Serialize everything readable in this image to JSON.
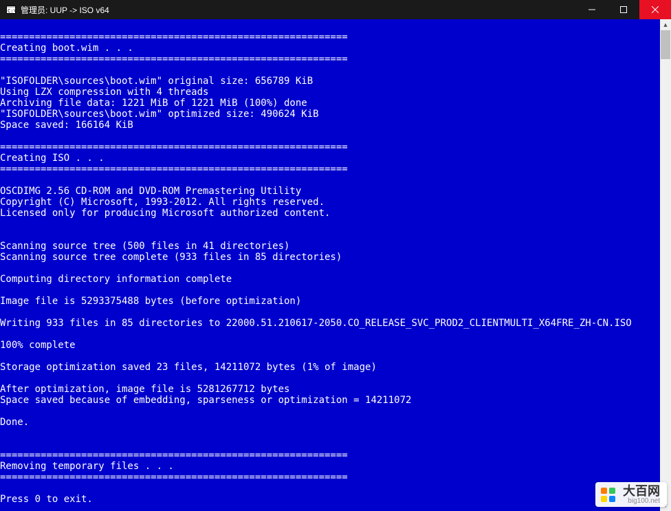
{
  "titlebar": {
    "title": "管理员:  UUP -> ISO v64"
  },
  "console": {
    "lines": [
      "",
      "============================================================",
      "Creating boot.wim . . .",
      "============================================================",
      "",
      "\"ISOFOLDER\\sources\\boot.wim\" original size: 656789 KiB",
      "Using LZX compression with 4 threads",
      "Archiving file data: 1221 MiB of 1221 MiB (100%) done",
      "\"ISOFOLDER\\sources\\boot.wim\" optimized size: 490624 KiB",
      "Space saved: 166164 KiB",
      "",
      "============================================================",
      "Creating ISO . . .",
      "============================================================",
      "",
      "OSCDIMG 2.56 CD-ROM and DVD-ROM Premastering Utility",
      "Copyright (C) Microsoft, 1993-2012. All rights reserved.",
      "Licensed only for producing Microsoft authorized content.",
      "",
      "",
      "Scanning source tree (500 files in 41 directories)",
      "Scanning source tree complete (933 files in 85 directories)",
      "",
      "Computing directory information complete",
      "",
      "Image file is 5293375488 bytes (before optimization)",
      "",
      "Writing 933 files in 85 directories to 22000.51.210617-2050.CO_RELEASE_SVC_PROD2_CLIENTMULTI_X64FRE_ZH-CN.ISO",
      "",
      "100% complete",
      "",
      "Storage optimization saved 23 files, 14211072 bytes (1% of image)",
      "",
      "After optimization, image file is 5281267712 bytes",
      "Space saved because of embedding, sparseness or optimization = 14211072",
      "",
      "Done.",
      "",
      "",
      "============================================================",
      "Removing temporary files . . .",
      "============================================================",
      "",
      "Press 0 to exit."
    ]
  },
  "watermark": {
    "title": "大百网",
    "sub": "big100.net"
  }
}
